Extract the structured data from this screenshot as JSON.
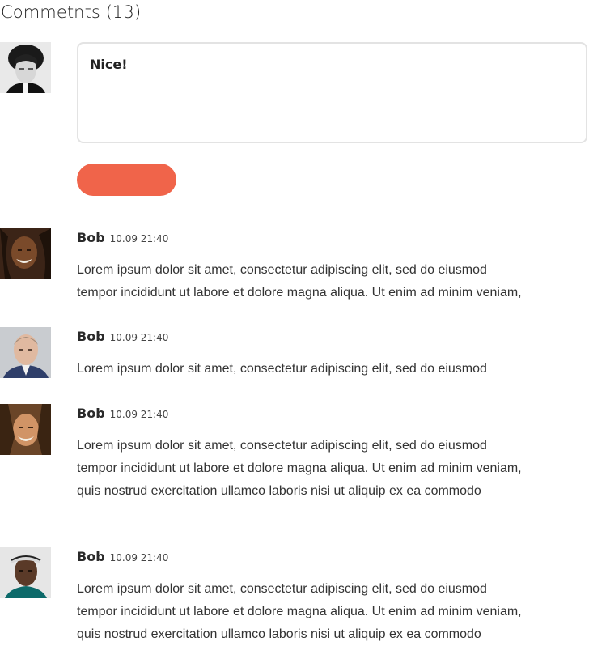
{
  "header": {
    "title": "Commetnts (13)"
  },
  "composer": {
    "value": "Nice!",
    "submit_label": ""
  },
  "comments": [
    {
      "author": "Bob",
      "time": "10.09 21:40",
      "lines": [
        "Lorem ipsum dolor sit amet, consectetur adipiscing elit, sed do eiusmod",
        "tempor incididunt ut labore et dolore magna aliqua. Ut enim ad minim veniam,"
      ]
    },
    {
      "author": "Bob",
      "time": "10.09 21:40",
      "lines": [
        "Lorem ipsum dolor sit amet, consectetur adipiscing elit, sed do eiusmod"
      ]
    },
    {
      "author": "Bob",
      "time": "10.09 21:40",
      "lines": [
        "Lorem ipsum dolor sit amet, consectetur adipiscing elit, sed do eiusmod",
        "tempor incididunt ut labore et dolore magna aliqua. Ut enim ad minim veniam,",
        "quis nostrud exercitation ullamco laboris nisi ut aliquip ex ea commodo"
      ]
    },
    {
      "author": "Bob",
      "time": "10.09 21:40",
      "lines": [
        "Lorem ipsum dolor sit amet, consectetur adipiscing elit, sed do eiusmod",
        "tempor incididunt ut labore et dolore magna aliqua. Ut enim ad minim veniam,",
        "quis nostrud exercitation ullamco laboris nisi ut aliquip ex ea commodo"
      ]
    }
  ],
  "colors": {
    "accent": "#f0644a",
    "border": "#e3e3e3"
  }
}
